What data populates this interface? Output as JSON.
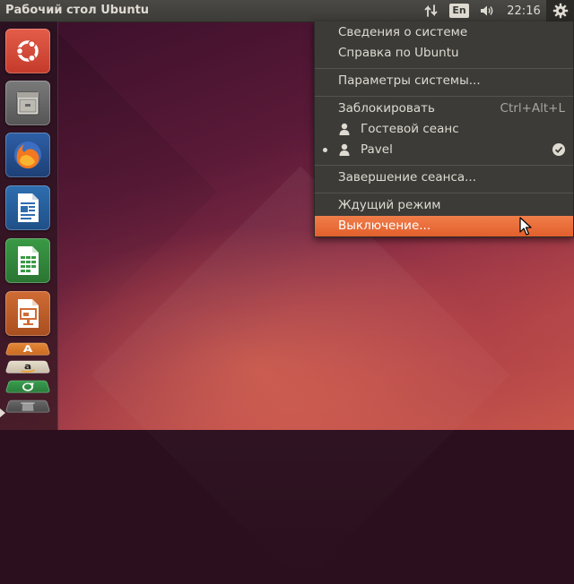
{
  "top_panel": {
    "title": "Рабочий стол Ubuntu",
    "language": "En",
    "clock": "22:16",
    "icons": {
      "network": "network-transfer-icon",
      "sound": "speaker-icon",
      "session": "gear-icon"
    }
  },
  "launcher": {
    "items": [
      {
        "icon": "ubuntu-dash-icon"
      },
      {
        "icon": "file-manager-icon"
      },
      {
        "icon": "firefox-icon"
      },
      {
        "icon": "libreoffice-writer-icon"
      },
      {
        "icon": "libreoffice-calc-icon"
      },
      {
        "icon": "libreoffice-impress-icon"
      },
      {
        "icon": "software-center-icon"
      },
      {
        "icon": "amazon-icon"
      },
      {
        "icon": "system-updater-icon"
      },
      {
        "icon": "trash-icon"
      }
    ]
  },
  "session_menu": {
    "about": "Сведения о системе",
    "help": "Справка по Ubuntu",
    "settings": "Параметры системы...",
    "lock": "Заблокировать",
    "lock_shortcut": "Ctrl+Alt+L",
    "guest": "Гостевой сеанс",
    "user": "Pavel",
    "logout": "Завершение сеанса...",
    "suspend": "Ждущий режим",
    "shutdown": "Выключение..."
  },
  "colors": {
    "panel": "#3c3b37",
    "panel_text": "#dfdbd2",
    "highlight": "#e8672f"
  }
}
